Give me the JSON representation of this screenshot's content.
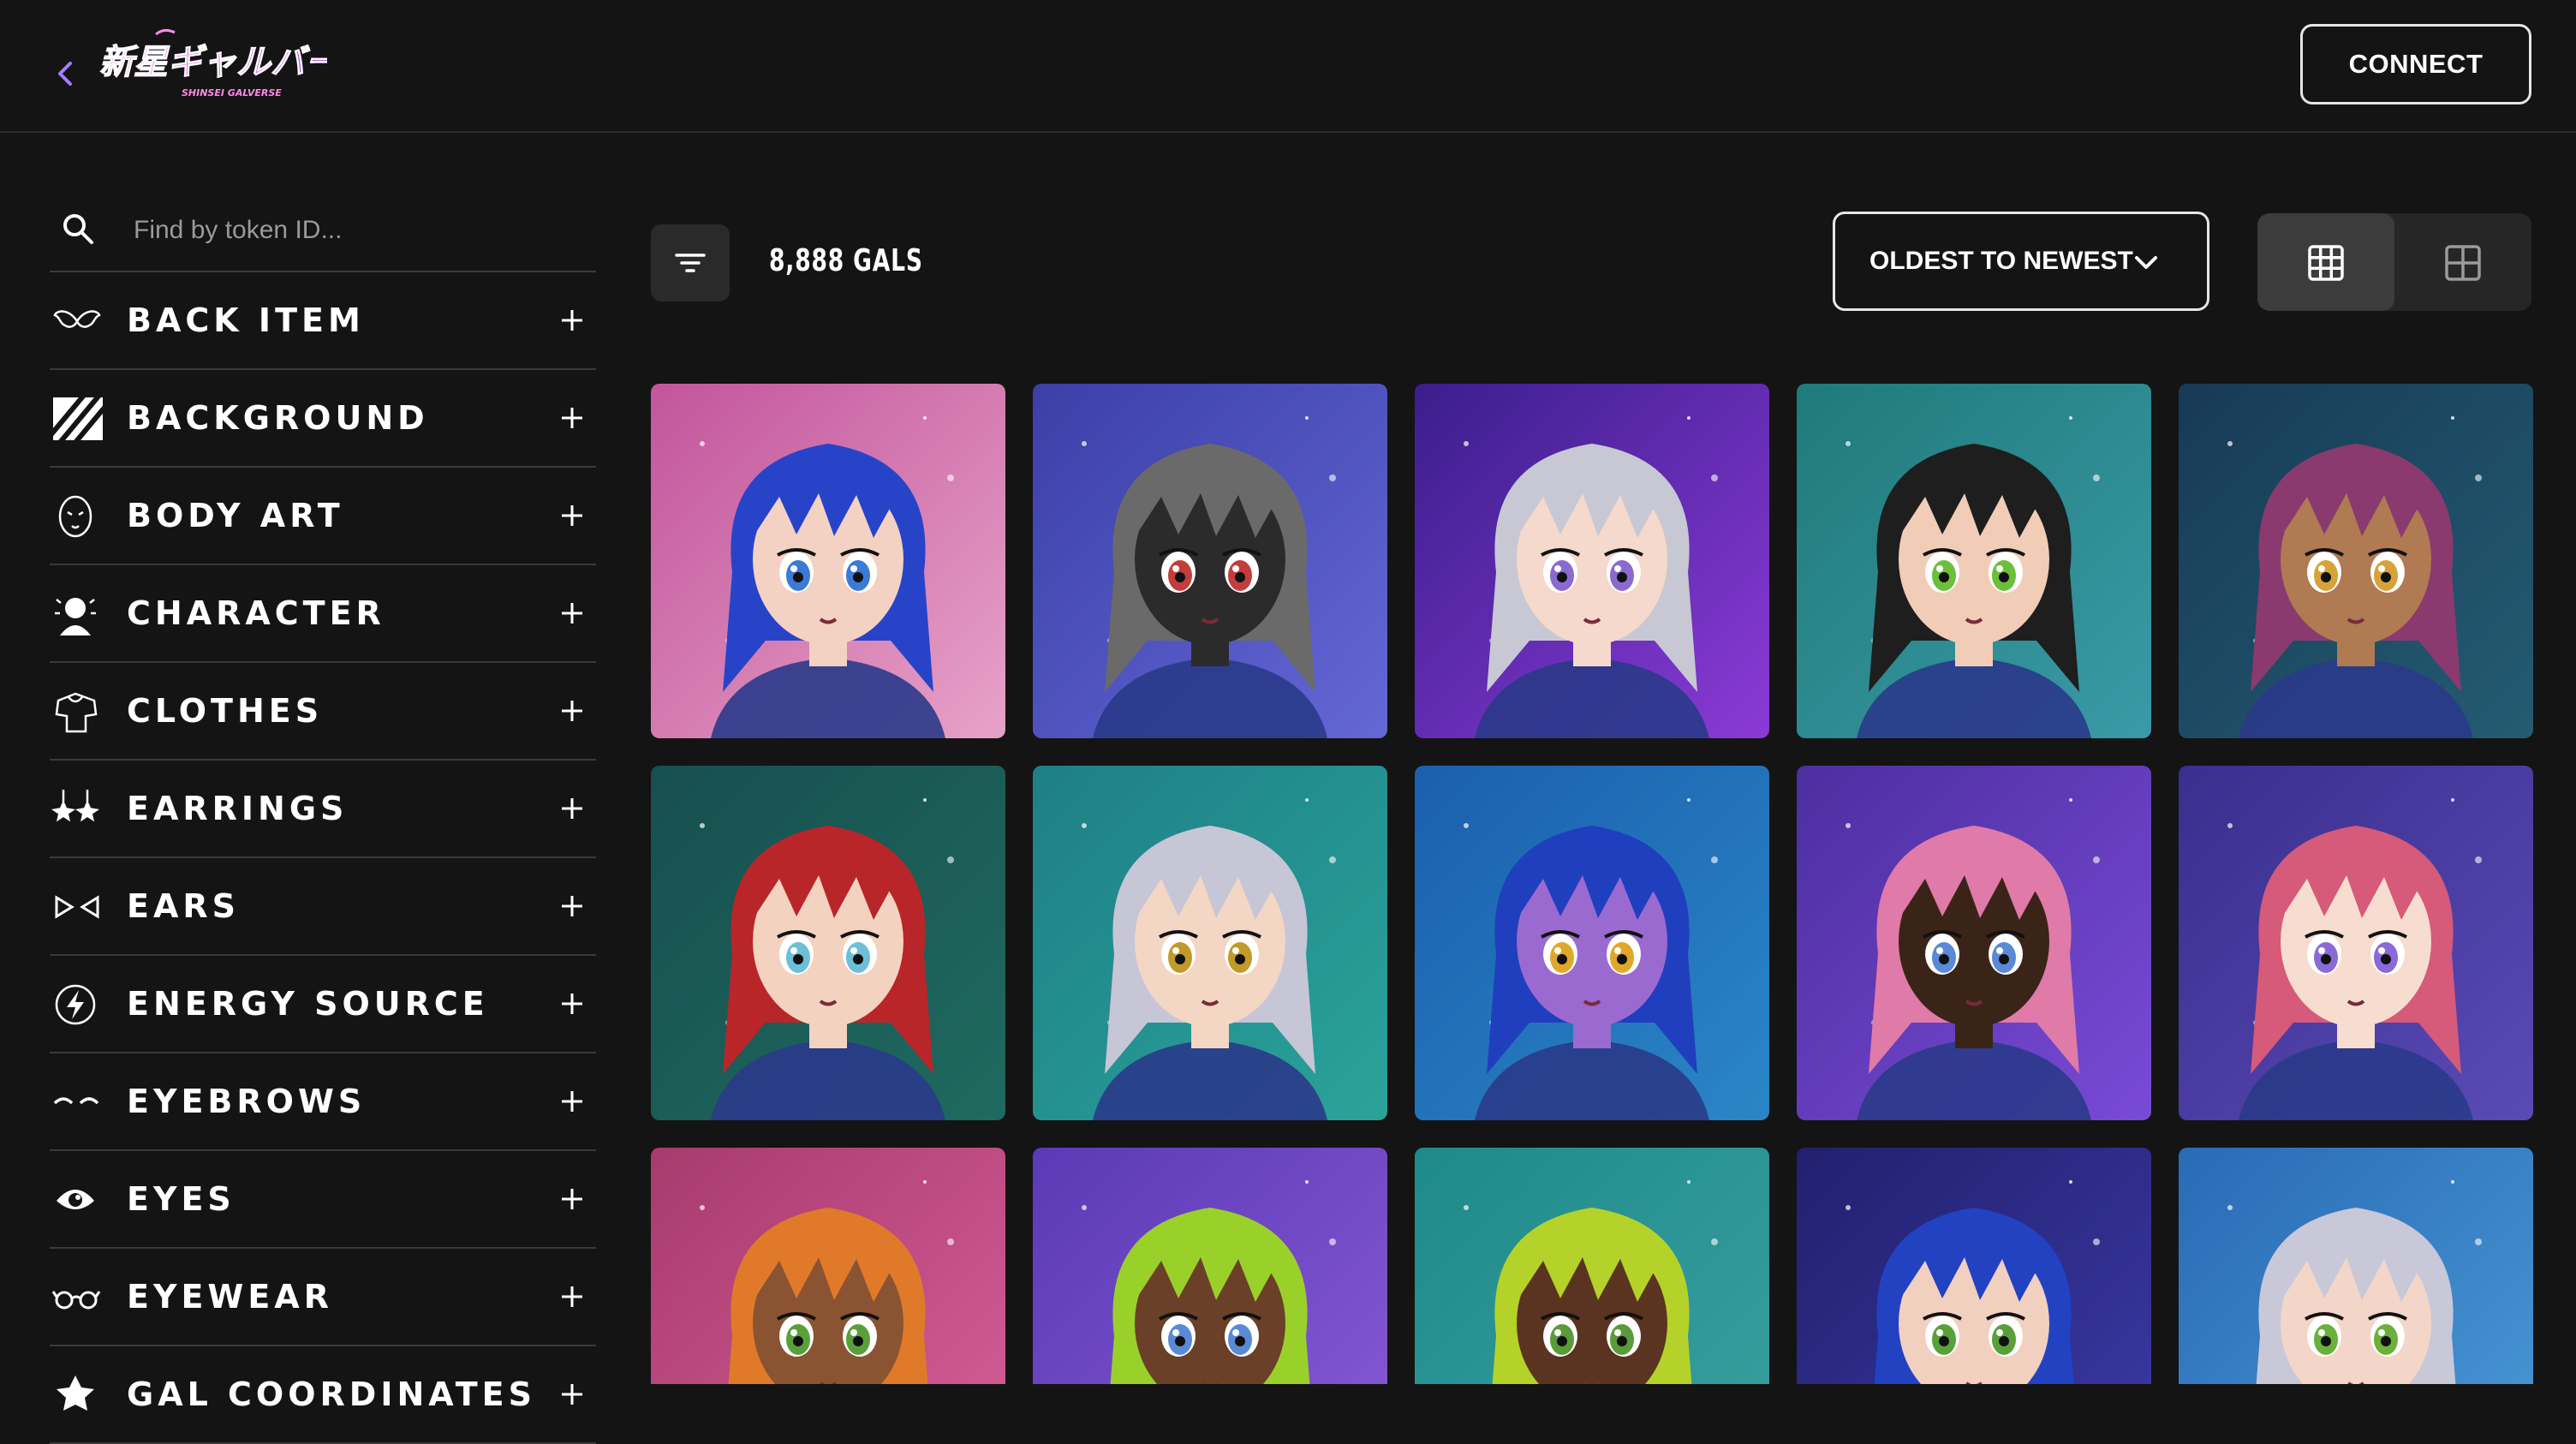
{
  "header": {
    "logo_text": "新星ギャルバース",
    "logo_subtext": "SHINSEI GALVERSE",
    "connect_label": "CONNECT"
  },
  "sidebar": {
    "search_placeholder": "Find by token ID...",
    "filters": [
      {
        "label": "BACK ITEM",
        "icon": "wings-icon"
      },
      {
        "label": "BACKGROUND",
        "icon": "stripes-icon"
      },
      {
        "label": "BODY ART",
        "icon": "mask-icon"
      },
      {
        "label": "CHARACTER",
        "icon": "character-icon"
      },
      {
        "label": "CLOTHES",
        "icon": "shirt-icon"
      },
      {
        "label": "EARRINGS",
        "icon": "earrings-icon"
      },
      {
        "label": "EARS",
        "icon": "ears-icon"
      },
      {
        "label": "ENERGY SOURCE",
        "icon": "lightning-icon"
      },
      {
        "label": "EYEBROWS",
        "icon": "eyebrows-icon"
      },
      {
        "label": "EYES",
        "icon": "eye-icon"
      },
      {
        "label": "EYEWEAR",
        "icon": "glasses-icon"
      },
      {
        "label": "GAL COORDINATES",
        "icon": "star-icon"
      }
    ]
  },
  "toolbar": {
    "count_label": "8,888 GALS",
    "sort_label": "OLDEST TO NEWEST",
    "view_modes": [
      "grid-small",
      "grid-large"
    ],
    "active_view": "grid-small"
  },
  "gallery": {
    "tiles": [
      {
        "bg1": "#c2559c",
        "bg2": "#e7a2c8",
        "hair": "#2744c9",
        "skin": "#f3d2c4",
        "eye": "#3b7ad6"
      },
      {
        "bg1": "#3b3fa6",
        "bg2": "#6467d6",
        "hair": "#6a6a6a",
        "skin": "#2b2b2b",
        "eye": "#c43d3d"
      },
      {
        "bg1": "#3a1e8c",
        "bg2": "#8b3ad6",
        "hair": "#c8c8d4",
        "skin": "#f4d9cc",
        "eye": "#8a6ad0"
      },
      {
        "bg1": "#1f7a7a",
        "bg2": "#3a9aa6",
        "hair": "#1e1e1e",
        "skin": "#f1cdb8",
        "eye": "#6cbf3a"
      },
      {
        "bg1": "#173a56",
        "bg2": "#245c72",
        "hair": "#8a3a6e",
        "skin": "#b07a52",
        "eye": "#d6a23a"
      },
      {
        "bg1": "#174f4f",
        "bg2": "#1f6a5f",
        "hair": "#b8262a",
        "skin": "#f3d2c0",
        "eye": "#6cbfd6"
      },
      {
        "bg1": "#1e7f86",
        "bg2": "#2aa39a",
        "hair": "#c6c6d6",
        "skin": "#f3d6c4",
        "eye": "#c29a2a"
      },
      {
        "bg1": "#1b5fae",
        "bg2": "#2a86c6",
        "hair": "#1f3fbf",
        "skin": "#9a6ad0",
        "eye": "#e0a82a"
      },
      {
        "bg1": "#4c2fa0",
        "bg2": "#7a4ad6",
        "hair": "#e07aa8",
        "skin": "#3a2418",
        "eye": "#5a8ad6"
      },
      {
        "bg1": "#3a2e8e",
        "bg2": "#5a4ab6",
        "hair": "#d65a7a",
        "skin": "#f6ddd0",
        "eye": "#8a6ad6"
      },
      {
        "bg1": "#a83a6e",
        "bg2": "#d6609a",
        "hair": "#e07a2a",
        "skin": "#8a5432",
        "eye": "#5aa03a"
      },
      {
        "bg1": "#5a3ab6",
        "bg2": "#8a5ad6",
        "hair": "#9ad02a",
        "skin": "#6a4028",
        "eye": "#5a8ad6"
      },
      {
        "bg1": "#1f8a8a",
        "bg2": "#3aa0a0",
        "hair": "#b4d22a",
        "skin": "#5a3420",
        "eye": "#5a9a3a"
      },
      {
        "bg1": "#22206e",
        "bg2": "#3a3aa6",
        "hair": "#2242c2",
        "skin": "#f1d0c0",
        "eye": "#5aa03a"
      },
      {
        "bg1": "#2a6ab6",
        "bg2": "#4a9ad6",
        "hair": "#c8c8d8",
        "skin": "#f3d6c8",
        "eye": "#6ab03a"
      }
    ]
  }
}
